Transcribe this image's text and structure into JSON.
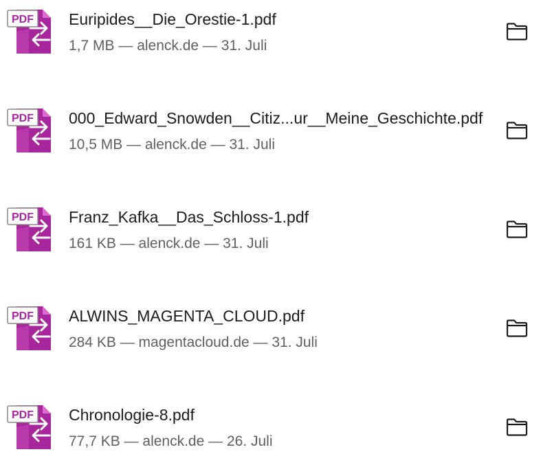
{
  "icons": {
    "file": "pdf-file-icon",
    "action": "folder-icon",
    "pdf_badge_text": "PDF"
  },
  "colors": {
    "pdf_icon_primary": "#a8269b",
    "pdf_icon_light": "#d96bd0",
    "pdf_badge_border": "#8a8a8a",
    "title_text": "#1b1b1b",
    "meta_text": "#5f5f5f"
  },
  "downloads": [
    {
      "filename": "Euripides__Die_Orestie-1.pdf",
      "details": "1,7 MB — alenck.de — 31. Juli"
    },
    {
      "filename": "000_Edward_Snowden__Citiz...ur__Meine_Geschichte.pdf",
      "details": "10,5 MB — alenck.de — 31. Juli"
    },
    {
      "filename": "Franz_Kafka__Das_Schloss-1.pdf",
      "details": "161 KB — alenck.de — 31. Juli"
    },
    {
      "filename": "ALWINS_MAGENTA_CLOUD.pdf",
      "details": "284 KB — magentacloud.de — 31. Juli"
    },
    {
      "filename": "Chronologie-8.pdf",
      "details": "77,7 KB — alenck.de — 26. Juli"
    }
  ]
}
